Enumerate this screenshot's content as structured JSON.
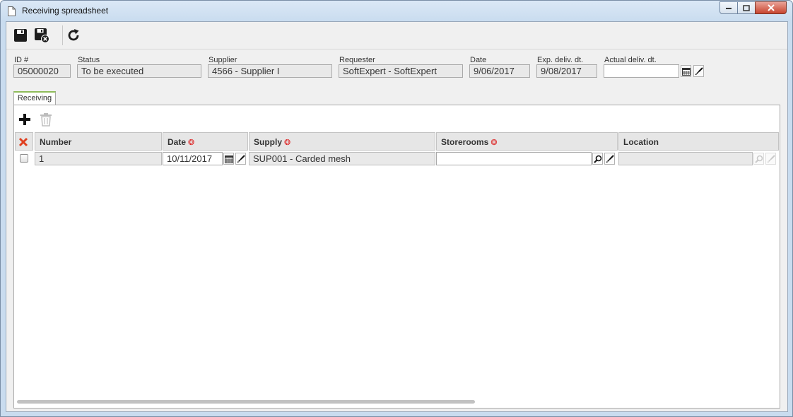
{
  "window": {
    "title": "Receiving spreadsheet"
  },
  "toolbar": {
    "save_icon": "save-icon",
    "save_close_icon": "save-close-icon",
    "refresh_icon": "refresh-icon"
  },
  "fields": {
    "id": {
      "label": "ID #",
      "value": "05000020"
    },
    "status": {
      "label": "Status",
      "value": "To be executed"
    },
    "supplier": {
      "label": "Supplier",
      "value": "4566 - Supplier I"
    },
    "requester": {
      "label": "Requester",
      "value": "SoftExpert - SoftExpert"
    },
    "date": {
      "label": "Date",
      "value": "9/06/2017"
    },
    "exp_deliv": {
      "label": "Exp. deliv. dt.",
      "value": "9/08/2017"
    },
    "actual_deliv": {
      "label": "Actual deliv. dt.",
      "value": ""
    }
  },
  "tabs": [
    {
      "label": "Receiving",
      "active": true
    }
  ],
  "grid": {
    "columns": [
      {
        "label": "Number",
        "required": false
      },
      {
        "label": "Date",
        "required": true
      },
      {
        "label": "Supply",
        "required": true
      },
      {
        "label": "Storerooms",
        "required": true
      },
      {
        "label": "Location",
        "required": false
      }
    ],
    "rows": [
      {
        "number": "1",
        "date": "10/11/2017",
        "supply": "SUP001 - Carded mesh",
        "storeroom": "",
        "location": ""
      }
    ]
  },
  "colors": {
    "tab_accent": "#8fbc5a",
    "required_marker": "#dd2222",
    "delete_marker": "#e04020"
  }
}
